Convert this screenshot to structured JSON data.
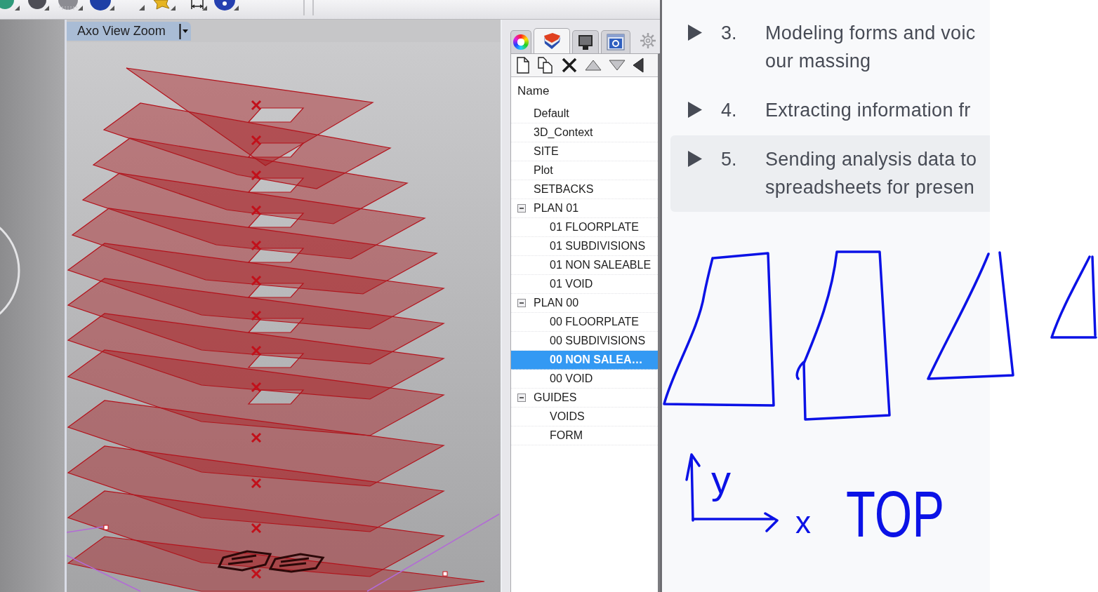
{
  "viewport": {
    "tab": "Axo View Zoom"
  },
  "layers_panel": {
    "tabs": [
      {
        "kind": "color",
        "selected": false
      },
      {
        "kind": "layers",
        "selected": true
      },
      {
        "kind": "display",
        "selected": false
      },
      {
        "kind": "help",
        "selected": false
      }
    ],
    "column_header": "Name",
    "layers": [
      {
        "name": "Default",
        "selected": false
      },
      {
        "name": "3D_Context",
        "selected": false
      },
      {
        "name": "SITE",
        "selected": false
      },
      {
        "name": "Plot",
        "selected": false
      },
      {
        "name": "SETBACKS",
        "selected": false
      },
      {
        "name": "PLAN 01",
        "selected": false,
        "expanded": true,
        "children": [
          {
            "name": "01 FLOORPLATE",
            "selected": false
          },
          {
            "name": "01 SUBDIVISIONS",
            "selected": false
          },
          {
            "name": "01 NON SALEABLE",
            "selected": false
          },
          {
            "name": "01 VOID",
            "selected": false
          }
        ]
      },
      {
        "name": "PLAN 00",
        "selected": false,
        "expanded": true,
        "children": [
          {
            "name": "00 FLOORPLATE",
            "selected": false
          },
          {
            "name": "00 SUBDIVISIONS",
            "selected": false
          },
          {
            "name": "00 NON SALEA…",
            "selected": true
          },
          {
            "name": "00 VOID",
            "selected": false
          }
        ]
      },
      {
        "name": "GUIDES",
        "selected": false,
        "expanded": true,
        "children": [
          {
            "name": "VOIDS",
            "selected": false
          },
          {
            "name": "FORM",
            "selected": false
          }
        ]
      }
    ]
  },
  "lessons": [
    {
      "number": "3.",
      "lines": [
        "Modeling forms and voic",
        "our massing"
      ],
      "expanded": false,
      "selected": false
    },
    {
      "number": "4.",
      "lines": [
        "Extracting information fr"
      ],
      "expanded": false,
      "selected": false
    },
    {
      "number": "5.",
      "lines": [
        "Sending analysis data to",
        "spreadsheets for presen"
      ],
      "expanded": false,
      "selected": true
    }
  ],
  "sketch": {
    "labels": [
      {
        "text": "y"
      },
      {
        "text": "x"
      },
      {
        "text": "TOP"
      }
    ]
  }
}
